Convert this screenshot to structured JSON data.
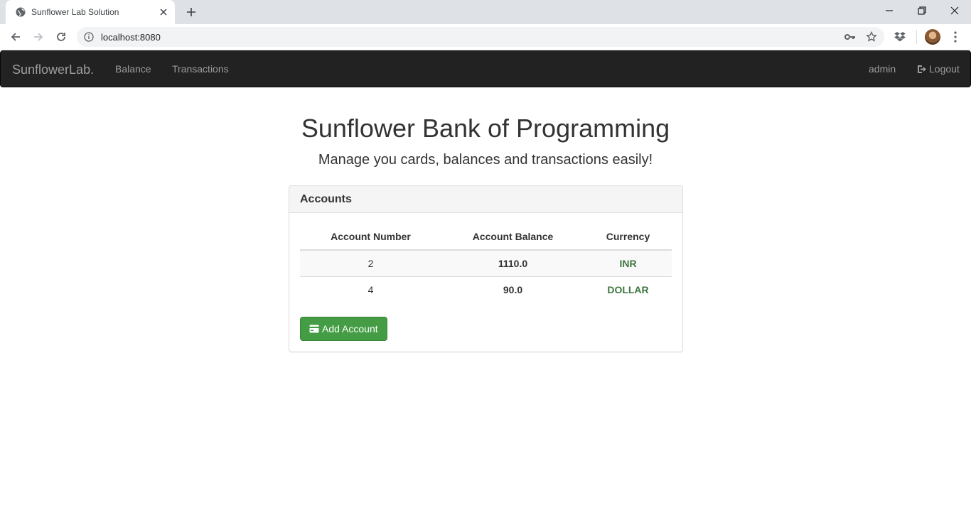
{
  "browser": {
    "tab_title": "Sunflower Lab Solution",
    "url": "localhost:8080"
  },
  "navbar": {
    "brand": "SunflowerLab.",
    "links": [
      "Balance",
      "Transactions"
    ],
    "user": "admin",
    "logout": "Logout"
  },
  "header": {
    "title": "Sunflower Bank of Programming",
    "subtitle": "Manage you cards, balances and transactions easily!"
  },
  "accounts": {
    "heading": "Accounts",
    "columns": [
      "Account Number",
      "Account Balance",
      "Currency"
    ],
    "rows": [
      {
        "number": "2",
        "balance": "1110.0",
        "currency": "INR"
      },
      {
        "number": "4",
        "balance": "90.0",
        "currency": "DOLLAR"
      }
    ],
    "add_button": "Add Account"
  },
  "colors": {
    "navbar_bg": "#222222",
    "success_green": "#449d44",
    "currency_text": "#3c763d"
  }
}
